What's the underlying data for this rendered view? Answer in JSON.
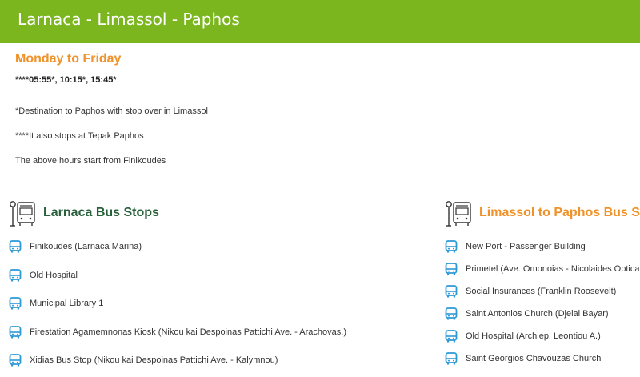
{
  "header": {
    "title": "Larnaca - Limassol - Paphos"
  },
  "schedule": {
    "heading": "Monday to Friday",
    "times": "****05:55*, 10:15*, 15:45*",
    "notes": [
      "*Destination to Paphos with stop over in Limassol",
      "****It also stops at Tepak Paphos",
      "The above hours start from Finikoudes"
    ]
  },
  "sections": {
    "larnaca": {
      "title": "Larnaca Bus Stops",
      "icon": "bus-stop-sign-icon",
      "stops": [
        "Finikoudes (Larnaca Marina)",
        "Old Hospital",
        "Municipal Library 1",
        "Firestation Agamemnonas Kiosk (Nikou kai Despoinas Pattichi Ave. - Arachovas.)",
        "Xidias Bus Stop (Nikou kai Despoinas Pattichi Ave. - Kalymnou)"
      ]
    },
    "limassol_paphos": {
      "title": "Limassol to Paphos Bus Stops",
      "icon": "bus-stop-sign-icon",
      "stops": [
        "New Port - Passenger Building",
        "Primetel (Ave. Omonoias - Nicolaides Optical)",
        "Social Insurances (Franklin Roosevelt)",
        "Saint Antonios Church (Djelal Bayar)",
        "Old Hospital (Archiep. Leontiou A.)",
        "Saint Georgios Chavouzas Church"
      ]
    }
  },
  "colors": {
    "header_bg": "#7bb61f",
    "accent_orange": "#f0922a",
    "section_green": "#27603a",
    "bus_icon_blue": "#2d9ad6"
  }
}
